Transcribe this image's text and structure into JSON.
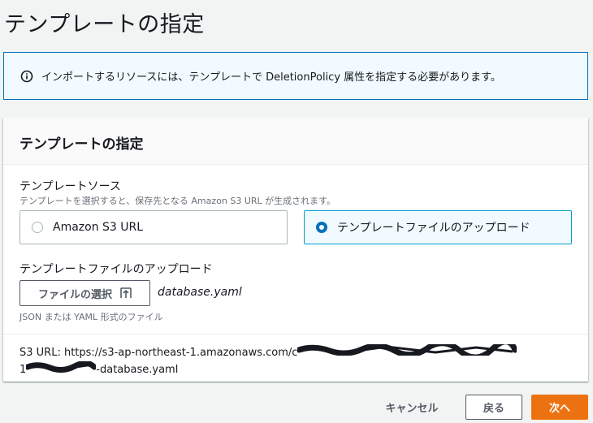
{
  "page": {
    "title": "テンプレートの指定"
  },
  "info": {
    "icon": "info-icon",
    "message": "インポートするリソースには、テンプレートで DeletionPolicy 属性を指定する必要があります。"
  },
  "panel": {
    "title": "テンプレートの指定",
    "source": {
      "label": "テンプレートソース",
      "description": "テンプレートを選択すると、保存先となる Amazon S3 URL が生成されます。",
      "options": [
        {
          "label": "Amazon S3 URL",
          "selected": false
        },
        {
          "label": "テンプレートファイルのアップロード",
          "selected": true
        }
      ]
    },
    "upload": {
      "label": "テンプレートファイルのアップロード",
      "button_label": "ファイルの選択",
      "button_icon": "upload-icon",
      "file_name": "database.yaml",
      "hint": "JSON または YAML 形式のファイル"
    },
    "s3": {
      "prefix": "S3 URL: https://s3-ap-northeast-1.amazonaws.com/c",
      "line2_prefix": "1",
      "suffix": "-database.yaml"
    }
  },
  "footer": {
    "cancel_label": "キャンセル",
    "back_label": "戻る",
    "next_label": "次へ"
  },
  "colors": {
    "primary": "#ec7211",
    "info_border": "#0073bb",
    "selected_border": "#00a1c9"
  }
}
